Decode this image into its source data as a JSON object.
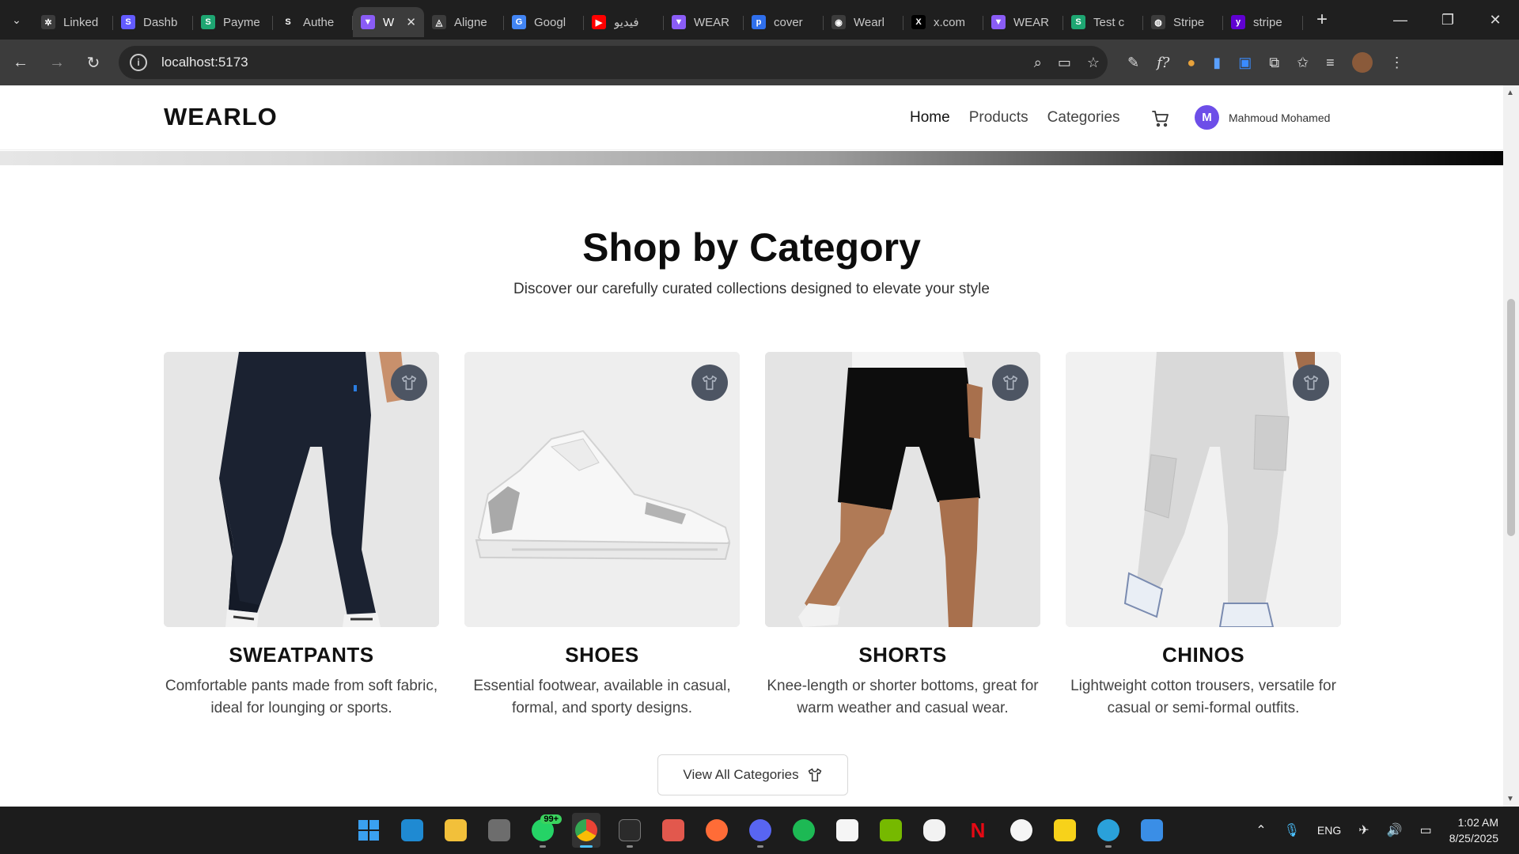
{
  "browser": {
    "tabs": [
      {
        "title": "Linked",
        "fav_color": "#3c3c3c",
        "fav_char": "✲"
      },
      {
        "title": "Dashb",
        "fav_color": "#635bff",
        "fav_char": "S"
      },
      {
        "title": "Payme",
        "fav_color": "#1ea672",
        "fav_char": "S"
      },
      {
        "title": "Authe",
        "fav_color": "#1f1f1f",
        "fav_char": "S"
      },
      {
        "title": "W",
        "fav_color": "#8a5cf6",
        "fav_char": "▼",
        "active": true
      },
      {
        "title": "Aligne",
        "fav_color": "#3c3c3c",
        "fav_char": "◬"
      },
      {
        "title": "Googl",
        "fav_color": "#4285f4",
        "fav_char": "G"
      },
      {
        "title": "فيديو",
        "fav_color": "#ff0000",
        "fav_char": "▶"
      },
      {
        "title": "WEAR",
        "fav_color": "#8a5cf6",
        "fav_char": "▼"
      },
      {
        "title": "cover",
        "fav_color": "#2f6fec",
        "fav_char": "p"
      },
      {
        "title": "Wearl",
        "fav_color": "#3c3c3c",
        "fav_char": "◉"
      },
      {
        "title": "x.com",
        "fav_color": "#000000",
        "fav_char": "X"
      },
      {
        "title": "WEAR",
        "fav_color": "#8a5cf6",
        "fav_char": "▼"
      },
      {
        "title": "Test c",
        "fav_color": "#1ea672",
        "fav_char": "S"
      },
      {
        "title": "Stripe",
        "fav_color": "#3c3c3c",
        "fav_char": "◍"
      },
      {
        "title": "stripe",
        "fav_color": "#6001d2",
        "fav_char": "y"
      }
    ],
    "url": "localhost:5173"
  },
  "site": {
    "logo": "WEARLO",
    "nav": [
      "Home",
      "Products",
      "Categories"
    ],
    "user_initial": "M",
    "user_name": "Mahmoud Mohamed"
  },
  "section": {
    "title": "Shop by Category",
    "subtitle": "Discover our carefully curated collections designed to elevate your style",
    "categories": [
      {
        "name": "SWEATPANTS",
        "desc": "Comfortable pants made from soft fabric, ideal for lounging or sports."
      },
      {
        "name": "SHOES",
        "desc": "Essential footwear, available in casual, formal, and sporty designs."
      },
      {
        "name": "SHORTS",
        "desc": "Knee-length or shorter bottoms, great for warm weather and casual wear."
      },
      {
        "name": "CHINOS",
        "desc": "Lightweight cotton trousers, versatile for casual or semi-formal outfits."
      }
    ],
    "view_all": "View All Categories"
  },
  "taskbar": {
    "chat_badge": "99+",
    "lang": "ENG",
    "time": "1:02 AM",
    "date": "8/25/2025"
  },
  "colors": {
    "accent": "#6d4ee8",
    "badge": "#4d5563"
  }
}
